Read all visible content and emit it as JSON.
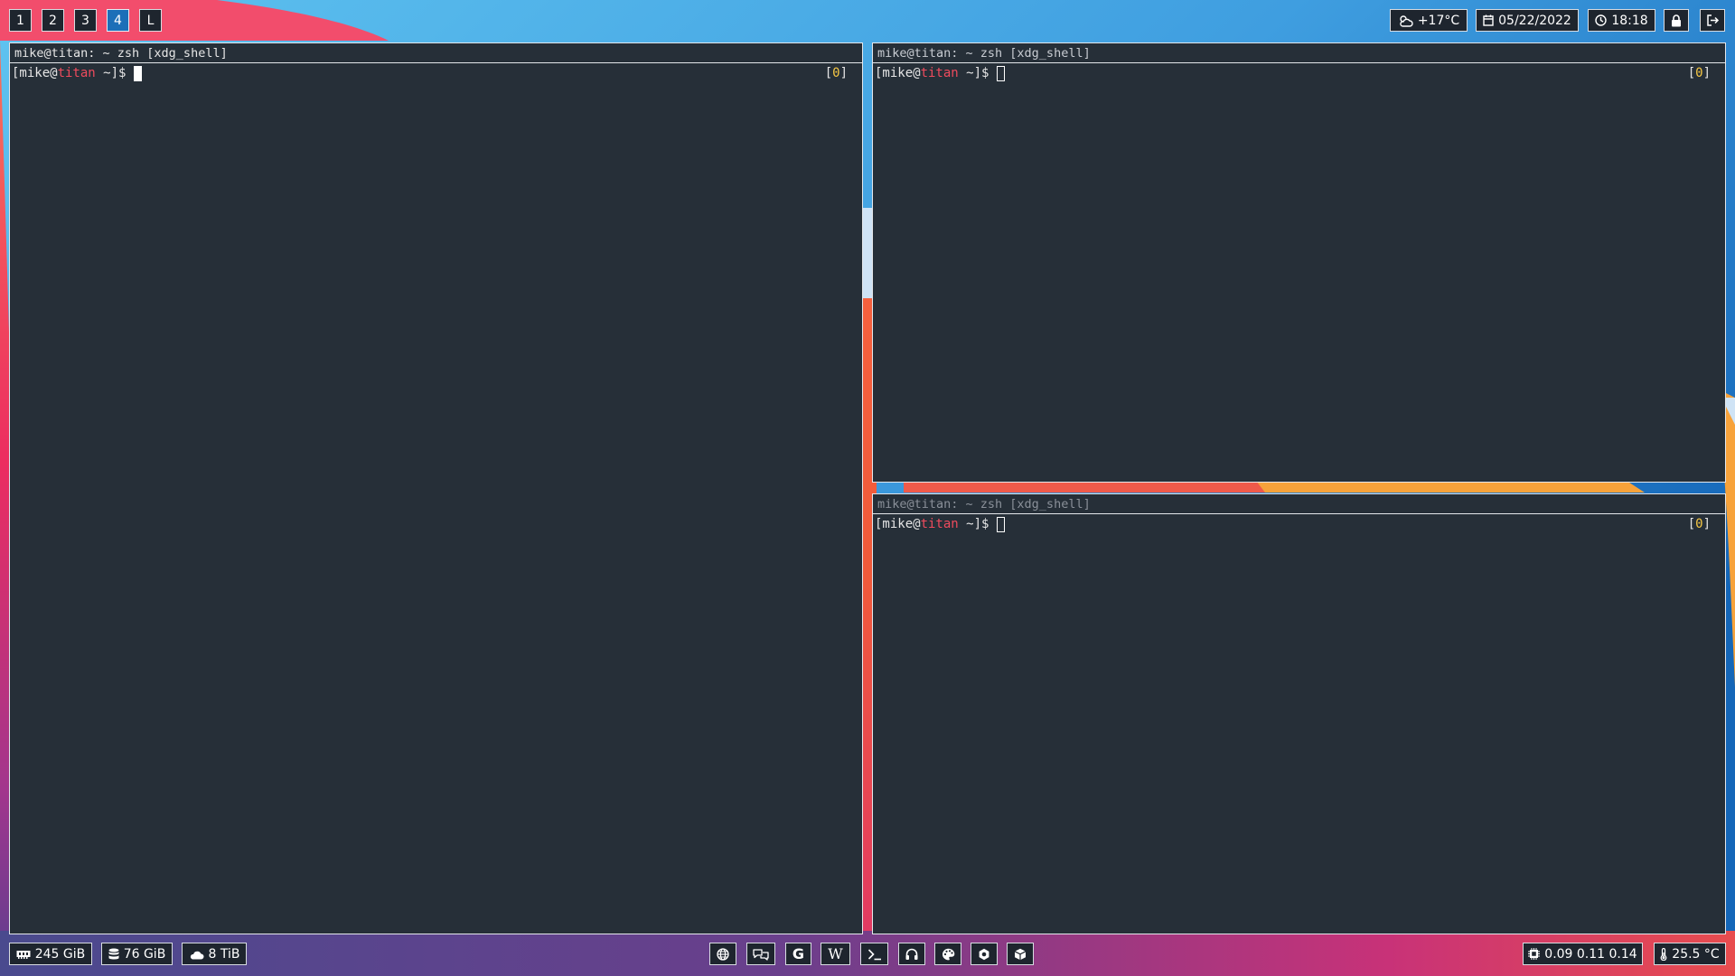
{
  "workspaces": [
    {
      "label": "1",
      "active": false
    },
    {
      "label": "2",
      "active": false
    },
    {
      "label": "3",
      "active": false
    },
    {
      "label": "4",
      "active": true
    },
    {
      "label": "L",
      "active": false
    }
  ],
  "status_top": {
    "weather": {
      "icon": "cloud-sun-icon",
      "text": "+17°C"
    },
    "date": {
      "icon": "calendar-icon",
      "text": "05/22/2022"
    },
    "time": {
      "icon": "clock-icon",
      "text": "18:18"
    },
    "lock": {
      "icon": "lock-icon"
    },
    "logout": {
      "icon": "logout-icon"
    }
  },
  "terminals": [
    {
      "title": "mike@titan: ~ zsh [xdg_shell]",
      "prompt_pre": "[mike@",
      "prompt_host": "titan",
      "prompt_post": " ~]$",
      "jobs_open": "[",
      "jobs_count": "0",
      "jobs_close": "]",
      "focused": true
    },
    {
      "title": "mike@titan: ~ zsh [xdg_shell]",
      "prompt_pre": "[mike@",
      "prompt_host": "titan",
      "prompt_post": " ~]$",
      "jobs_open": "[",
      "jobs_count": "0",
      "jobs_close": "]",
      "focused": false
    },
    {
      "title": "mike@titan: ~ zsh [xdg_shell]",
      "prompt_pre": "[mike@",
      "prompt_host": "titan",
      "prompt_post": " ~]$",
      "jobs_open": "[",
      "jobs_count": "0",
      "jobs_close": "]",
      "focused": false
    }
  ],
  "status_bottom_left": {
    "memory": {
      "icon": "memory-icon",
      "text": "245 GiB"
    },
    "disk": {
      "icon": "database-icon",
      "text": "76 GiB"
    },
    "cloud": {
      "icon": "cloud-icon",
      "text": "8 TiB"
    }
  },
  "launcher": [
    {
      "icon": "globe-icon"
    },
    {
      "icon": "chat-icon"
    },
    {
      "icon": "google-icon",
      "glyph": "G"
    },
    {
      "icon": "wikipedia-icon",
      "glyph": "W"
    },
    {
      "icon": "terminal-icon"
    },
    {
      "icon": "headphones-icon"
    },
    {
      "icon": "palette-icon"
    },
    {
      "icon": "settings-icon"
    },
    {
      "icon": "package-icon"
    }
  ],
  "status_bottom_right": {
    "cpu_load": {
      "icon": "cpu-icon",
      "text": "0.09 0.11 0.14"
    },
    "temperature": {
      "icon": "thermometer-icon",
      "text": "25.5 °C"
    }
  },
  "colors": {
    "accent_active": "#1c6fb8",
    "terminal_bg": "#262f38",
    "prompt_host": "#ee4b5d",
    "jobs_count": "#f6c744",
    "bar_button_bg": "#1e252e"
  }
}
